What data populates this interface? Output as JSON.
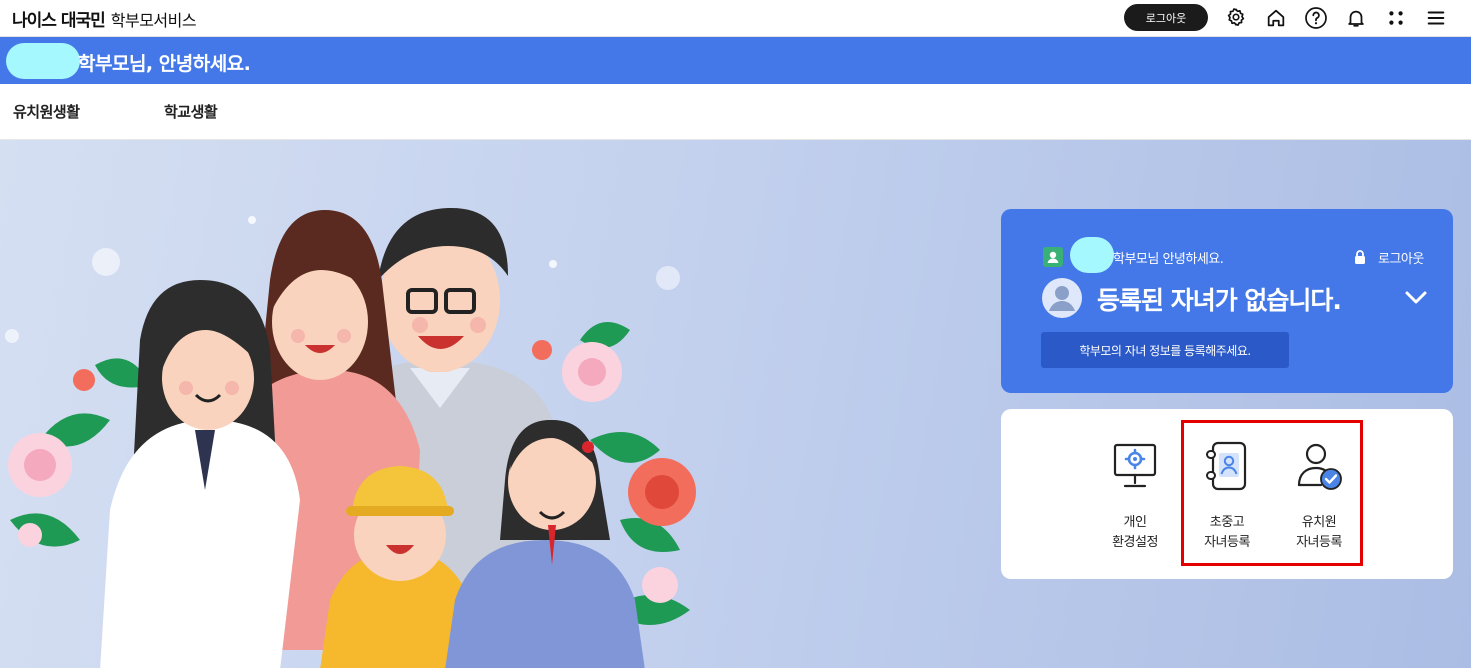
{
  "header": {
    "brand_bold": "나이스 대국민",
    "brand_sub": "학부모서비스",
    "logout_label": "로그아웃",
    "icons": [
      "gear-icon",
      "home-icon",
      "help-icon",
      "bell-icon",
      "apps-icon",
      "menu-icon"
    ]
  },
  "greeting": {
    "text": "학부모님, 안녕하세요."
  },
  "nav": {
    "items": [
      {
        "label": "유치원생활"
      },
      {
        "label": "학교생활"
      }
    ]
  },
  "info_card": {
    "greeting": "학부모님 안녕하세요.",
    "logout_label": "로그아웃",
    "title": "등록된 자녀가 없습니다.",
    "register_prompt": "학부모의 자녀 정보를 등록해주세요."
  },
  "menu": {
    "items": [
      {
        "line1": "개인",
        "line2": "환경설정",
        "icon": "monitor-settings-icon"
      },
      {
        "line1": "초중고",
        "line2": "자녀등록",
        "icon": "contact-book-icon"
      },
      {
        "line1": "유치원",
        "line2": "자녀등록",
        "icon": "person-check-icon"
      }
    ]
  },
  "colors": {
    "primary": "#4478e8",
    "button_dark": "#2b59c7",
    "highlight": "#e40000",
    "name_blob": "#a6f8ff"
  }
}
